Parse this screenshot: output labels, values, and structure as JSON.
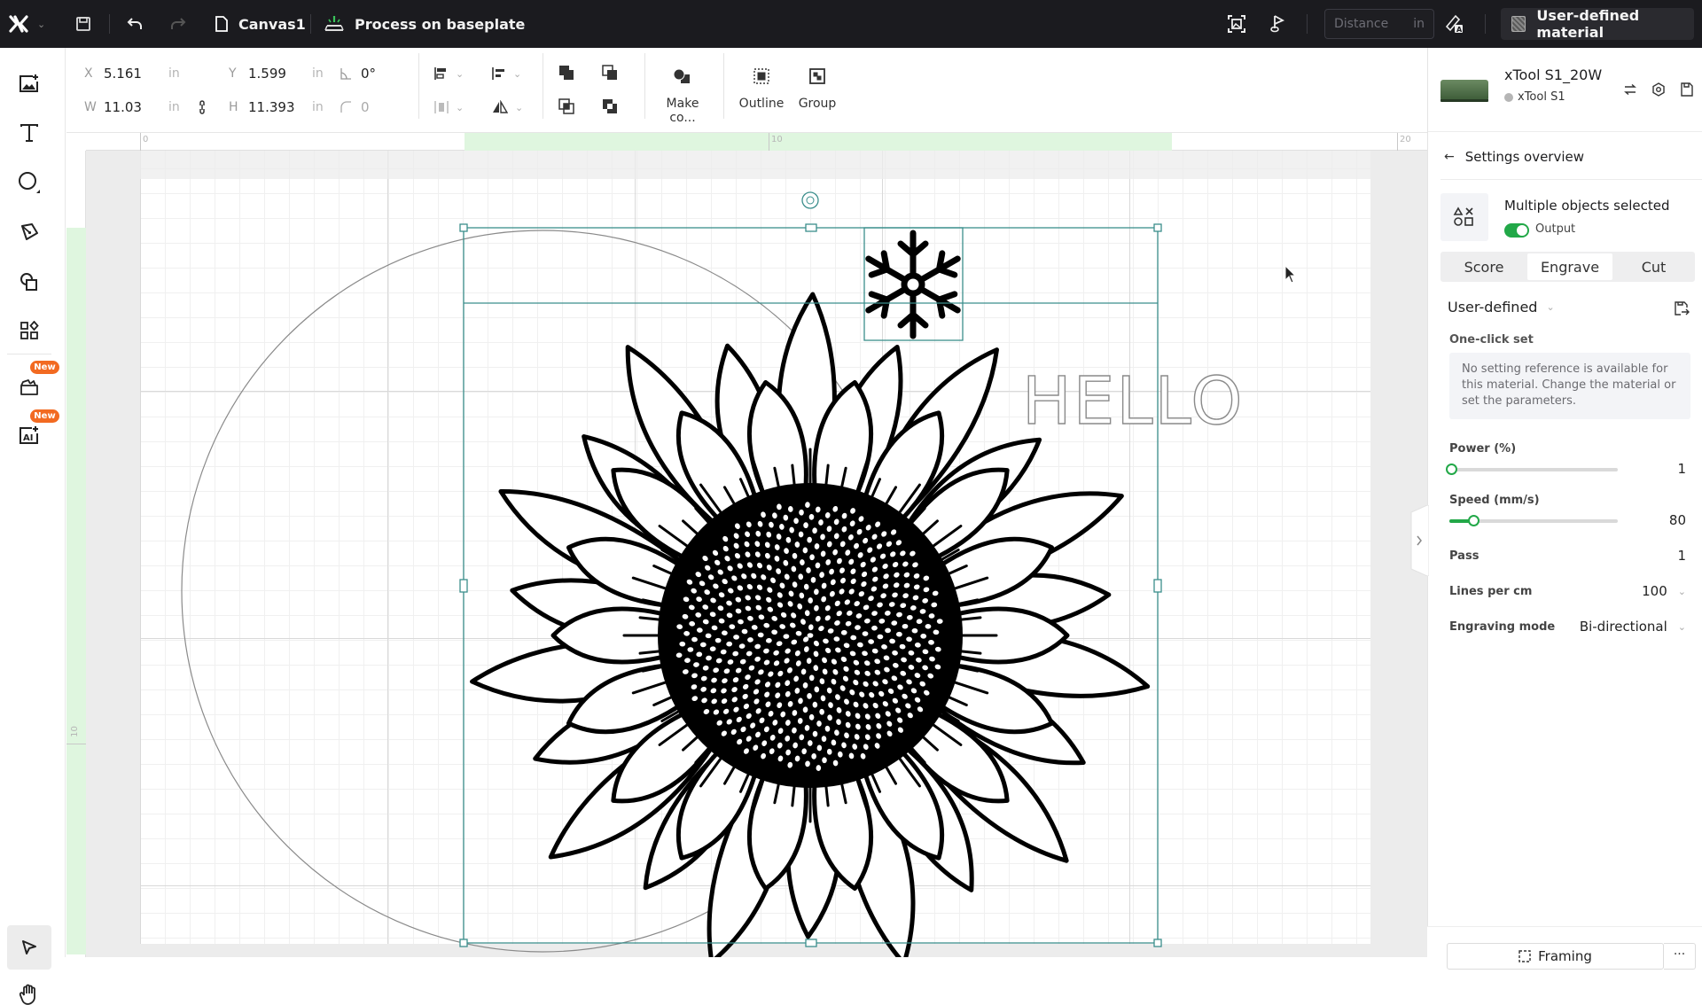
{
  "topbar": {
    "app_logo": "xtool-logo",
    "document_name": "Canvas1",
    "process_mode": "Process on baseplate",
    "distance_placeholder": "Distance",
    "distance_unit": "in",
    "material_label": "User-defined material"
  },
  "left_toolbar": {
    "tools": [
      {
        "name": "add-image",
        "icon": "image-plus-icon"
      },
      {
        "name": "text",
        "icon": "text-icon"
      },
      {
        "name": "shape",
        "icon": "circle-icon"
      },
      {
        "name": "pen",
        "icon": "pen-icon"
      },
      {
        "name": "shapes",
        "icon": "shapes-icon"
      },
      {
        "name": "elements",
        "icon": "elements-icon"
      },
      {
        "name": "projects",
        "icon": "folder-icon",
        "badge": "New"
      },
      {
        "name": "ai",
        "icon": "ai-image-icon",
        "badge": "New"
      }
    ],
    "select_tool": "select-icon",
    "hand_tool": "hand-icon"
  },
  "properties": {
    "x_label": "X",
    "x": "5.161",
    "x_unit": "in",
    "y_label": "Y",
    "y": "1.599",
    "y_unit": "in",
    "rotation": "0°",
    "w_label": "W",
    "w": "11.03",
    "w_unit": "in",
    "h_label": "H",
    "h": "11.393",
    "h_unit": "in",
    "corner_radius": "0",
    "make_compound_label": "Make co...",
    "outline_label": "Outline",
    "group_label": "Group"
  },
  "rulers": {
    "top_ticks": [
      "0",
      "10",
      "20"
    ],
    "left_ticks": [
      "10"
    ]
  },
  "canvas": {
    "hello_text": "HELLO",
    "objects": [
      "circle",
      "sunflower",
      "snowflake",
      "HELLO text"
    ]
  },
  "right_panel": {
    "machine_name": "xTool S1_20W",
    "machine_model": "xTool S1",
    "back_label": "Settings overview",
    "selection_title": "Multiple objects selected",
    "output_label": "Output",
    "output_enabled": true,
    "tabs": [
      {
        "label": "Score",
        "active": false
      },
      {
        "label": "Engrave",
        "active": true
      },
      {
        "label": "Cut",
        "active": false
      }
    ],
    "preset": "User-defined",
    "one_click_label": "One-click set",
    "info_text": "No setting reference is available for this material. Change the material or set the parameters.",
    "power_label": "Power (%)",
    "power_value": "1",
    "power_fraction": 0.01,
    "speed_label": "Speed (mm/s)",
    "speed_value": "80",
    "speed_fraction": 0.14,
    "pass_label": "Pass",
    "pass_value": "1",
    "lines_label": "Lines per cm",
    "lines_value": "100",
    "mode_label": "Engraving mode",
    "mode_value": "Bi-directional",
    "framing_label": "Framing",
    "more_label": "..."
  },
  "colors": {
    "accent_green": "#22a848",
    "selection_teal": "#3b8e8c",
    "badge_orange": "#f26a21",
    "topbar_bg": "#1b1b1f"
  }
}
